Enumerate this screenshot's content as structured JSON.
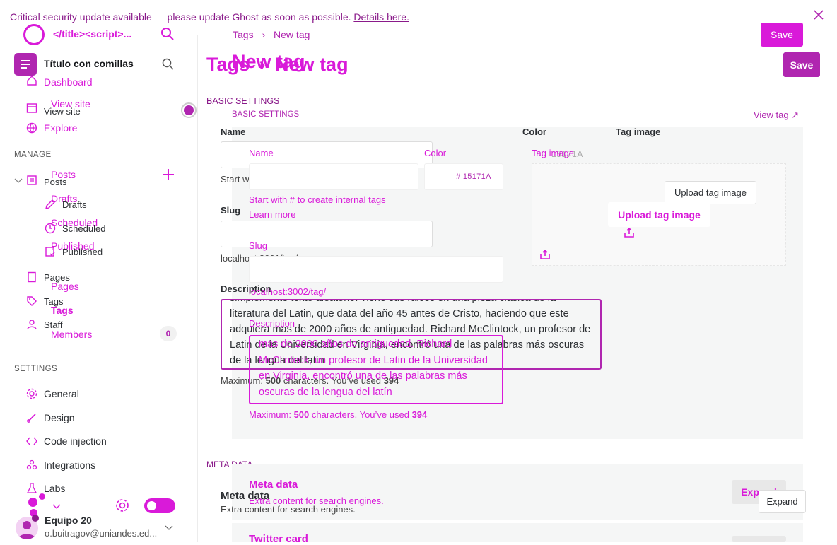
{
  "banner": {
    "message": "Critical security update available — please update Ghost as soon as possible.",
    "link": "Details here."
  },
  "sidebar": {
    "site_title_ghost": "</title><script>...",
    "site_title": "Título con comillas",
    "nav_top": [
      {
        "label": "Dashboard",
        "icon": "home-icon"
      },
      {
        "label": "View site",
        "icon": "browser-icon"
      },
      {
        "label": "View site",
        "icon": "browser-icon"
      },
      {
        "label": "Explore",
        "icon": "globe-icon"
      }
    ],
    "manage_heading": "MANAGE",
    "posts": "Posts",
    "posts_ghost": "Posts",
    "drafts": "Drafts",
    "drafts_ghost": "Drafts",
    "scheduled": "Scheduled",
    "scheduled_ghost": "Scheduled",
    "published": "Published",
    "published_ghost": "Published",
    "pages": "Pages",
    "pages_ghost": "Pages",
    "tags": "Tags",
    "tags_ghost": "Tags",
    "staff": "Staff",
    "members": "Members",
    "members_count": "0",
    "settings_heading": "SETTINGS",
    "settings_items": [
      {
        "label": "General",
        "icon": "gear-icon"
      },
      {
        "label": "Design",
        "icon": "brush-icon"
      },
      {
        "label": "Code injection",
        "icon": "code-icon"
      },
      {
        "label": "Integrations",
        "icon": "integrations-icon"
      },
      {
        "label": "Labs",
        "icon": "flask-icon"
      }
    ],
    "user_name": "Equipo 20",
    "user_email": "o.buitragov@uniandes.ed..."
  },
  "main": {
    "breadcrumb_parent": "Tags",
    "breadcrumb_sep": "›",
    "breadcrumb_current": "New tag",
    "title_parent": "Tags",
    "title_arrow": "›",
    "title_current": "New tag",
    "title_ghost": "New tag",
    "save": "Save",
    "basic_settings": "BASIC SETTINGS",
    "view_tag": "View tag ↗",
    "name_label": "Name",
    "color_label": "Color",
    "tag_image_label": "Tag image",
    "color_value": "15171A",
    "color_ghost": "# 15171A",
    "hint_internal": "Start with # to create internal tags",
    "learn_more": "Learn more",
    "upload_tag_image": "Upload tag image",
    "slug_label": "Slug",
    "slug_url_1": "localhost:3001/tag/",
    "slug_url_2": "localhost:3002/tag/",
    "description_label": "Description",
    "description_text": "simplemente texto aleatorio. Tiene sus raices en una pieza clasica de la literatura del Latin, que data del año 45 antes de Cristo, haciendo que este adquiera mas de 2000 años de antiguedad. Richard McClintock, un profesor de Latin de la Universidad en Virginia, encontró una de las palabras más oscuras de la lengua del latín",
    "description_text_2": "mas de 2000 años de antiguedad. Richard McClintock, un profesor de Latin de la Universidad en Virginia, encontró una de las palabras más oscuras de la lengua del latín",
    "max_prefix": "Maximum:",
    "max_count": "500",
    "max_middle": "characters. You’ve used",
    "max_used": "394",
    "meta_heading": "META DATA",
    "meta_title": "Meta data",
    "meta_sub": "Extra content for search engines.",
    "expand": "Expand",
    "twitter_card": "Twitter card"
  },
  "colors": {
    "accent": "#d91ad9",
    "bg": "#ffffff",
    "panel": "#f5f6f6"
  }
}
